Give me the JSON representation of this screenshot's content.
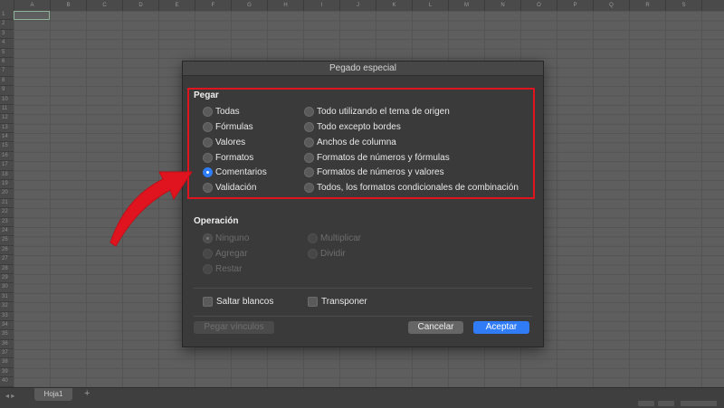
{
  "spreadsheet": {
    "columns": [
      "A",
      "B",
      "C",
      "D",
      "E",
      "F",
      "G",
      "H",
      "I",
      "J",
      "K",
      "L",
      "M",
      "N",
      "O",
      "P",
      "Q",
      "R",
      "S"
    ],
    "rows": [
      "1",
      "2",
      "3",
      "4",
      "5",
      "6",
      "7",
      "8",
      "9",
      "10",
      "11",
      "12",
      "13",
      "14",
      "15",
      "16",
      "17",
      "18",
      "19",
      "20",
      "21",
      "22",
      "23",
      "24",
      "25",
      "26",
      "27",
      "28",
      "29",
      "30",
      "31",
      "32",
      "33",
      "34",
      "35",
      "36",
      "37",
      "38",
      "39",
      "40"
    ],
    "sheet_tab": "Hoja1",
    "add_sheet": "+"
  },
  "dialog": {
    "title": "Pegado especial",
    "pegar": {
      "heading": "Pegar",
      "left": [
        "Todas",
        "Fórmulas",
        "Valores",
        "Formatos",
        "Comentarios",
        "Validación"
      ],
      "right": [
        "Todo utilizando el tema de origen",
        "Todo excepto bordes",
        "Anchos de columna",
        "Formatos de números y fórmulas",
        "Formatos de números y valores",
        "Todos, los formatos condicionales de combinación"
      ],
      "selected": "Comentarios"
    },
    "operacion": {
      "heading": "Operación",
      "left": [
        "Ninguno",
        "Agregar",
        "Restar"
      ],
      "right": [
        "Multiplicar",
        "Dividir"
      ]
    },
    "checks": {
      "skip_blanks": "Saltar blancos",
      "transpose": "Transponer"
    },
    "buttons": {
      "paste_links": "Pegar vínculos",
      "cancel": "Cancelar",
      "ok": "Aceptar"
    }
  },
  "colors": {
    "accent": "#2f7cf6",
    "highlight": "#e0141e"
  }
}
